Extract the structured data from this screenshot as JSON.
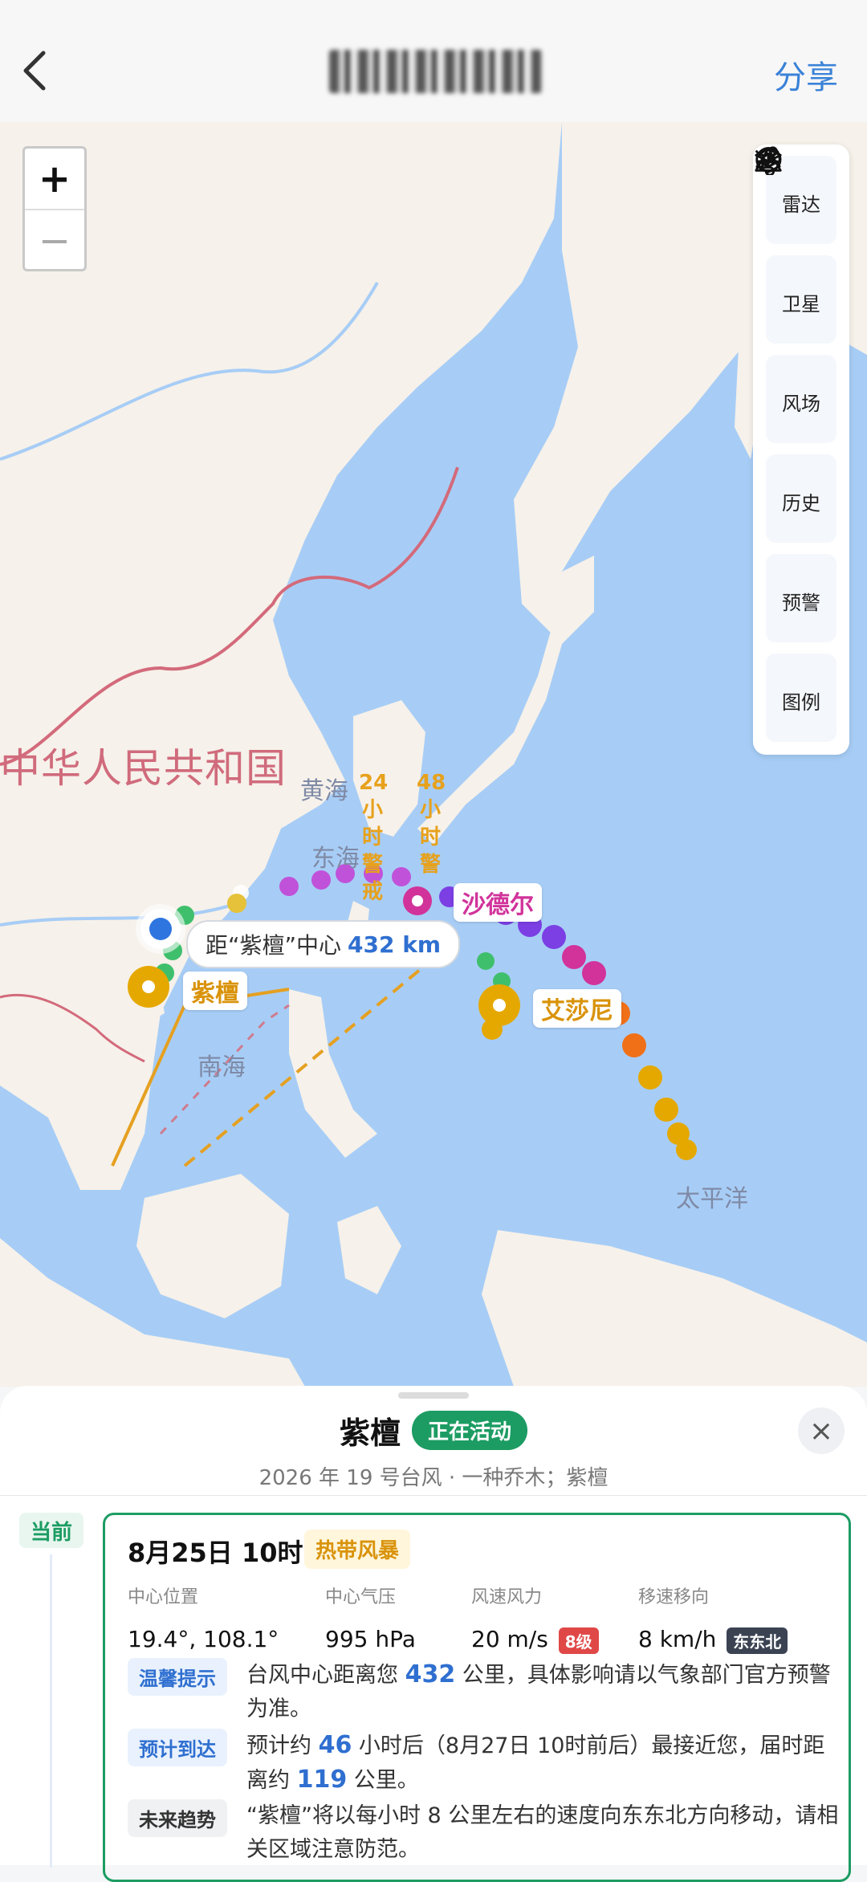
{
  "header": {
    "share_label": "分享"
  },
  "map": {
    "zoom": {
      "in_label": "+",
      "out_label": "−"
    },
    "tools": [
      {
        "label": "雷达",
        "icon": "radar-icon"
      },
      {
        "label": "卫星",
        "icon": "satellite-icon"
      },
      {
        "label": "风场",
        "icon": "wind-icon"
      },
      {
        "label": "历史",
        "icon": "history-icon"
      },
      {
        "label": "预警",
        "icon": "warning-icon"
      },
      {
        "label": "图例",
        "icon": "layers-icon"
      }
    ],
    "labels": {
      "country": "中华人民共和国",
      "yellow_sea": "黄海",
      "east_sea": "东海",
      "south_sea": "南海",
      "pacific": "太平洋",
      "line24": "24小时警戒",
      "line48": "48小时警"
    },
    "storms": [
      {
        "name": "沙德尔",
        "color": "#d1339a"
      },
      {
        "name": "紫檀",
        "color": "#e5a800"
      },
      {
        "name": "艾莎尼",
        "color": "#e5a800"
      }
    ],
    "distance": {
      "prefix": "距“紫檀”中心",
      "value": "432 km"
    }
  },
  "sheet": {
    "name": "紫檀",
    "status": "正在活动",
    "subtitle": "2026 年 19 号台风 · 一种乔木；紫檀",
    "close_label": "×",
    "now_label": "当前",
    "time": "8月25日 10时",
    "intensity": "热带风暴",
    "fields": [
      {
        "label": "中心位置",
        "value": "19.4°, 108.1°"
      },
      {
        "label": "中心气压",
        "value": "995 hPa"
      },
      {
        "label": "风速风力",
        "value": "20 m/s",
        "chip": "8级"
      },
      {
        "label": "移速移向",
        "value": "8 km/h",
        "chip": "东东北"
      }
    ],
    "tips": [
      {
        "tag": "温馨提示",
        "pre": "台风中心距离您 ",
        "num": "432",
        "post": " 公里，具体影响请以气象部门官方预警为准。"
      },
      {
        "tag": "预计到达",
        "pre": "预计约 ",
        "num": "46",
        "mid": " 小时后（8月27日 10时前后）最接近您，届时距离约 ",
        "num2": "119",
        "post": " 公里。"
      },
      {
        "tag": "未来趋势",
        "text": "“紫檀”将以每小时 8 公里左右的速度向东东北方向移动，请相关区域注意防范。"
      }
    ],
    "colors": {
      "accent": "#1c9c63",
      "link": "#2f6fd0",
      "level_chip": "#e04848",
      "dir_chip": "#3b4353"
    }
  }
}
